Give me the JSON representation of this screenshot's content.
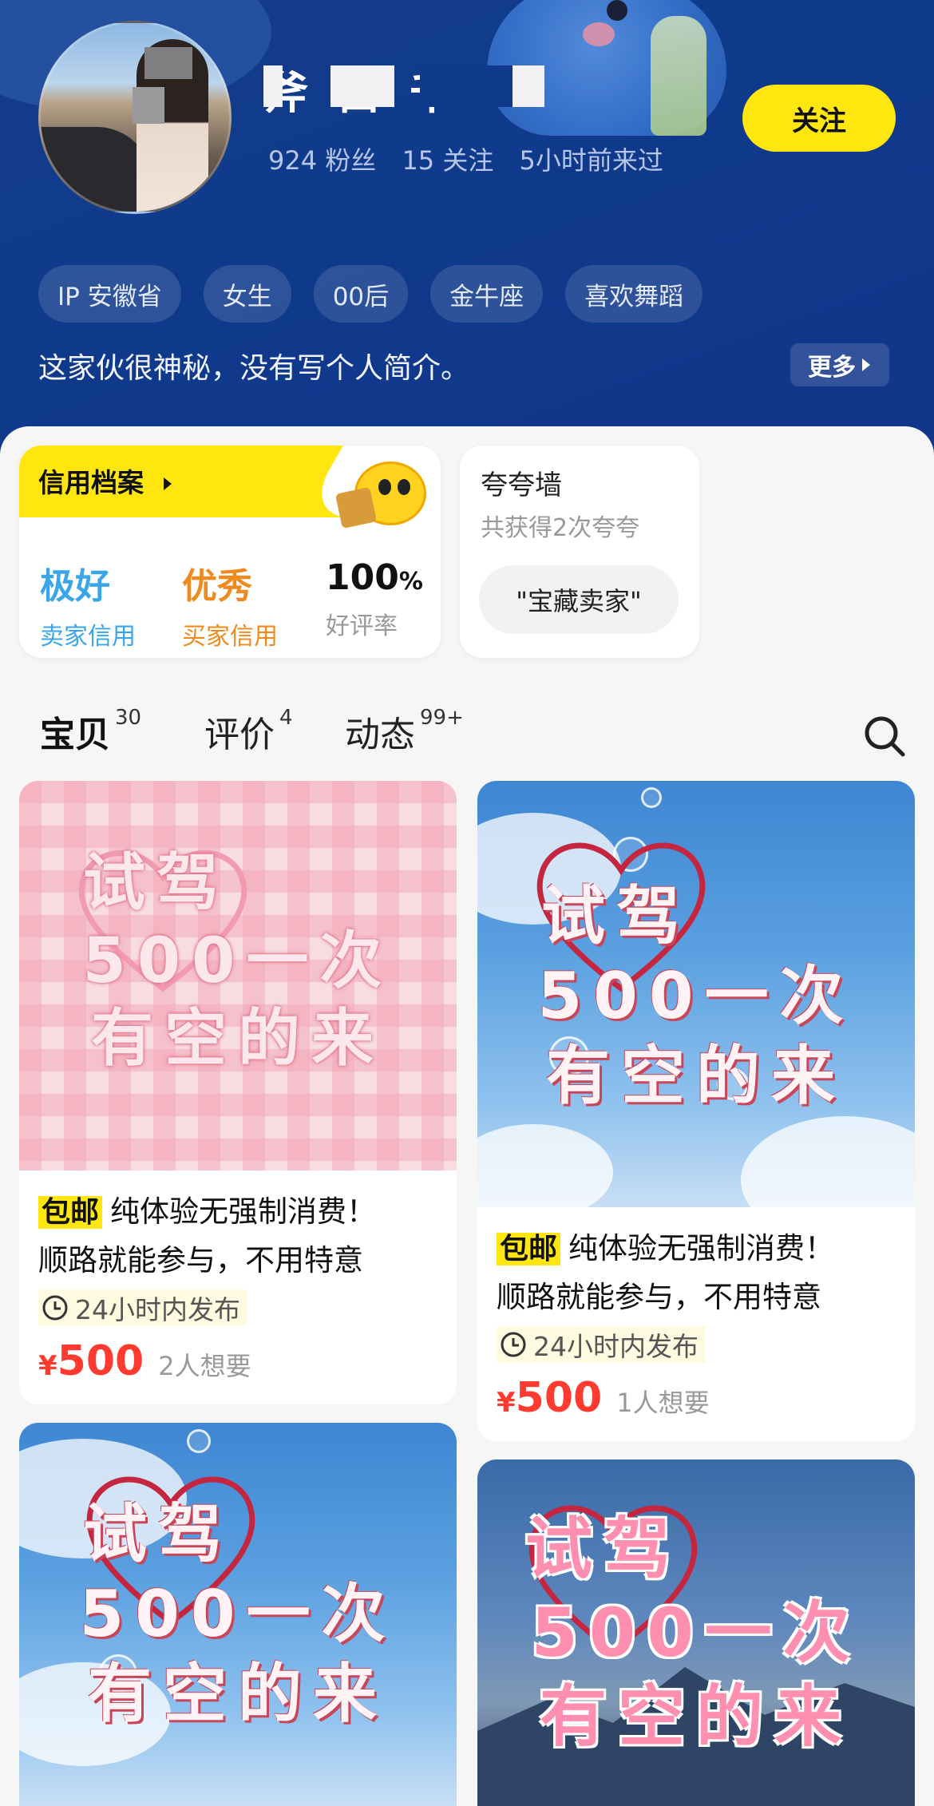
{
  "profile": {
    "nickname": "斧 白 千",
    "stats": {
      "fans": "924 粉丝",
      "following": "15 关注",
      "last_seen": "5小时前来过"
    },
    "follow_label": "关注",
    "tags": [
      "IP 安徽省",
      "女生",
      "00后",
      "金牛座",
      "喜欢舞蹈"
    ],
    "bio": "这家伙很神秘，没有写个人简介。",
    "more_label": "更多"
  },
  "credit": {
    "title": "信用档案",
    "seller_credit": {
      "value": "极好",
      "label": "卖家信用",
      "color": "#3aa6e8"
    },
    "buyer_credit": {
      "value": "优秀",
      "label": "买家信用",
      "color": "#ef8a1f"
    },
    "good_rate": {
      "value": "100",
      "unit": "%",
      "label": "好评率"
    }
  },
  "praise_wall": {
    "title": "夸夸墙",
    "subtitle": "共获得2次夸夸",
    "chip": "\"宝藏卖家\""
  },
  "tabs": [
    {
      "label": "宝贝",
      "count": "30",
      "active": true
    },
    {
      "label": "评价",
      "count": "4",
      "active": false
    },
    {
      "label": "动态",
      "count": "99+",
      "active": false
    }
  ],
  "poster_text": {
    "line1": "试驾",
    "line2": "500一次",
    "line3": "有空的来"
  },
  "items": [
    {
      "badge": "包邮",
      "desc_line1": "纯体验无强制消费！",
      "desc_line2": "顺路就能参与，不用特意",
      "time": "24小时内发布",
      "currency": "¥",
      "price": "500",
      "want": "2人想要"
    },
    {
      "badge": "包邮",
      "desc_line1": "纯体验无强制消费！",
      "desc_line2": "顺路就能参与，不用特意",
      "time": "24小时内发布",
      "currency": "¥",
      "price": "500",
      "want": "1人想要"
    }
  ],
  "colors": {
    "header_bg": "#12398a",
    "accent_yellow": "#ffe60f",
    "price_red": "#ff3b2f"
  },
  "icons": [
    "search-icon",
    "clock-icon",
    "chevron-right-icon"
  ]
}
